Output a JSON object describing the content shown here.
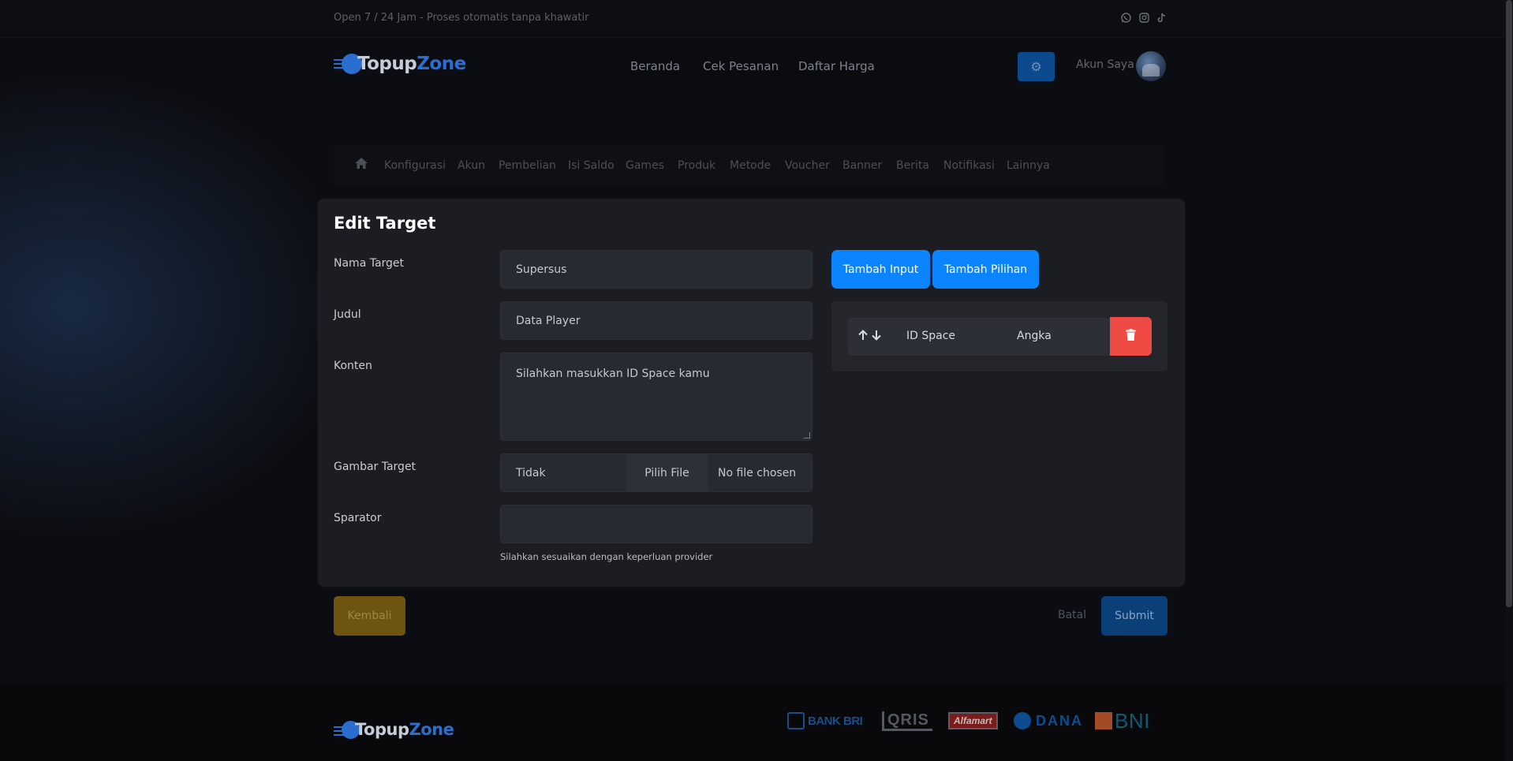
{
  "topbar": {
    "tagline": "Open 7 / 24 Jam - Proses otomatis tanpa khawatir",
    "social_icons": [
      "whatsapp-icon",
      "instagram-icon",
      "tiktok-icon"
    ]
  },
  "brand": {
    "part1": "Topup",
    "part2": "Zone",
    "accent_color": "#2a6fd0"
  },
  "nav": {
    "links": [
      "Beranda",
      "Cek Pesanan",
      "Daftar Harga"
    ],
    "settings_icon": "gear-icon",
    "account_label": "Akun Saya"
  },
  "admin_menu": {
    "home_icon": "home-icon",
    "items": [
      "Konfigurasi",
      "Akun",
      "Pembelian",
      "Isi Saldo",
      "Games",
      "Produk",
      "Metode",
      "Voucher",
      "Banner",
      "Berita",
      "Notifikasi",
      "Lainnya"
    ]
  },
  "form": {
    "title": "Edit Target",
    "fields": {
      "nama_target": {
        "label": "Nama Target",
        "value": "Supersus"
      },
      "judul": {
        "label": "Judul",
        "value": "Data Player"
      },
      "konten": {
        "label": "Konten",
        "value": "Silahkan masukkan ID Space kamu"
      },
      "gambar_target": {
        "label": "Gambar Target",
        "value": "Tidak",
        "file_button": "Pilih File",
        "file_status": "No file chosen"
      },
      "sparator": {
        "label": "Sparator",
        "value": "",
        "helper": "Silahkan sesuaikan dengan keperluan provider"
      }
    },
    "buttons": {
      "add_input": "Tambah Input",
      "add_choice": "Tambah Pilihan"
    },
    "target_inputs": [
      {
        "name": "ID Space",
        "type": "Angka"
      }
    ],
    "accent_color": "#0a84ff",
    "danger_color": "#f04a44"
  },
  "actions": {
    "back": "Kembali",
    "cancel": "Batal",
    "submit": "Submit"
  },
  "footer": {
    "brand": {
      "part1": "Topup",
      "part2": "Zone"
    },
    "payments": {
      "bri": "BANK BRI",
      "qris": "QRIS",
      "alfamart": "Alfamart",
      "dana": "DANA",
      "bni": "BNI"
    }
  }
}
